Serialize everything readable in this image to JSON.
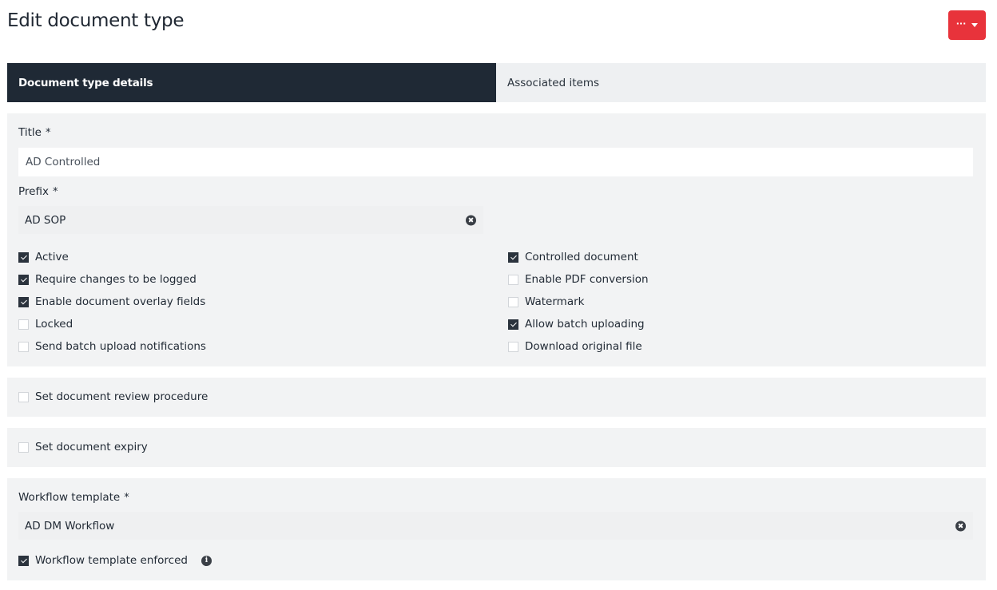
{
  "page": {
    "title": "Edit document type"
  },
  "actions": {
    "menu_dots": "···"
  },
  "tabs": [
    {
      "label": "Document type details",
      "active": true
    },
    {
      "label": "Associated items",
      "active": false
    }
  ],
  "form": {
    "title_label": "Title",
    "title_value": "AD Controlled",
    "prefix_label": "Prefix",
    "prefix_value": "AD SOP",
    "required_mark": "*",
    "left_options": [
      {
        "label": "Active",
        "checked": true
      },
      {
        "label": "Require changes to be logged",
        "checked": true
      },
      {
        "label": "Enable document overlay fields",
        "checked": true
      },
      {
        "label": "Locked",
        "checked": false
      },
      {
        "label": "Send batch upload notifications",
        "checked": false
      }
    ],
    "right_options": [
      {
        "label": "Controlled document",
        "checked": true
      },
      {
        "label": "Enable PDF conversion",
        "checked": false
      },
      {
        "label": "Watermark",
        "checked": false
      },
      {
        "label": "Allow batch uploading",
        "checked": true
      },
      {
        "label": "Download original file",
        "checked": false
      }
    ]
  },
  "review": {
    "label": "Set document review procedure",
    "checked": false
  },
  "expiry": {
    "label": "Set document expiry",
    "checked": false
  },
  "workflow": {
    "label": "Workflow template",
    "value": "AD DM Workflow",
    "enforced_label": "Workflow template enforced",
    "enforced_checked": true,
    "info_glyph": "i"
  },
  "colors": {
    "accent": "#e8333b",
    "active_tab": "#1f2935",
    "panel": "#f2f3f4"
  }
}
